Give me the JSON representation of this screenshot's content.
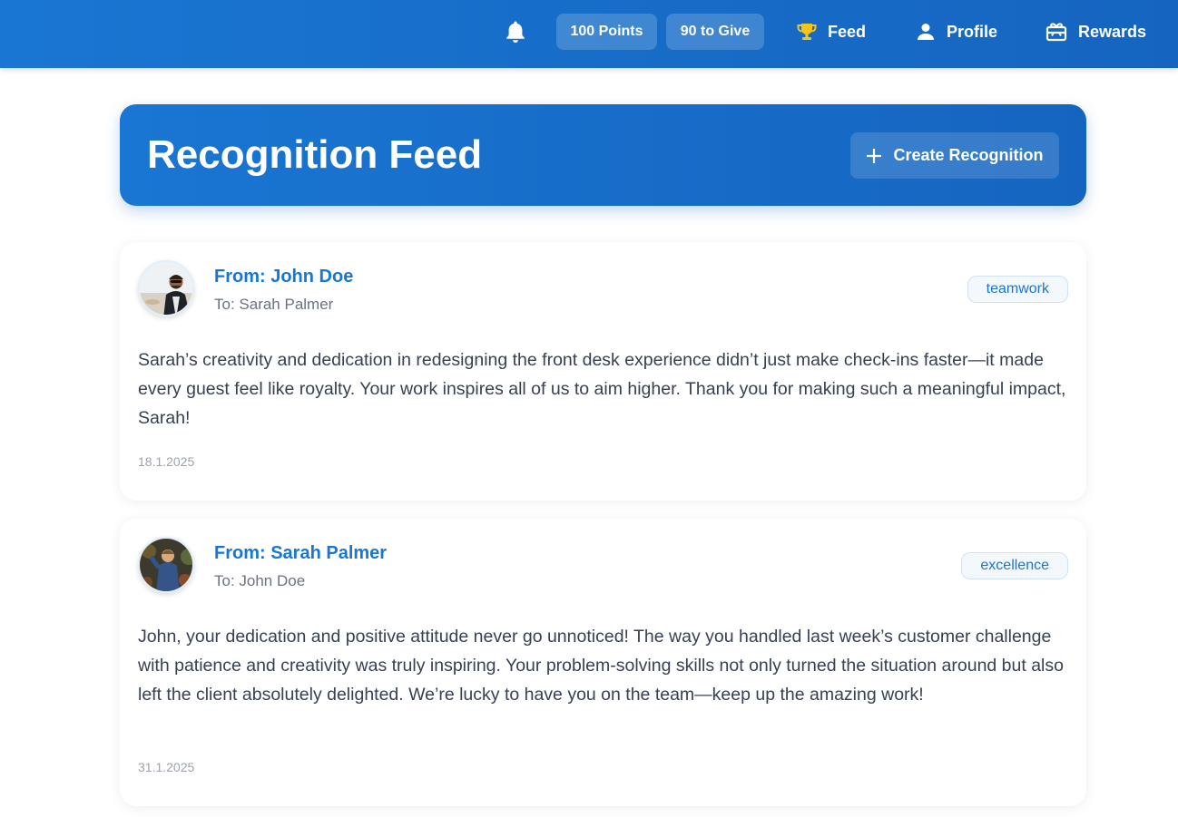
{
  "header": {
    "notifications_icon": "bell-icon",
    "points_label": "100 Points",
    "give_label": "90 to Give",
    "nav": [
      {
        "label": "Feed",
        "icon": "trophy-icon",
        "icon_color": "#f5c518"
      },
      {
        "label": "Profile",
        "icon": "person-icon"
      },
      {
        "label": "Rewards",
        "icon": "gift-card-icon"
      }
    ],
    "background": "#1976d2"
  },
  "hero": {
    "title": "Recognition Feed",
    "create_label": "Create Recognition",
    "create_icon": "plus-icon"
  },
  "recognitions": [
    {
      "from": "From: John Doe",
      "to": "To: Sarah Palmer",
      "tag": "teamwork",
      "message": "Sarah’s creativity and dedication in redesigning the front desk experience didn’t just make check-ins faster—it made every guest feel like royalty. Your work inspires all of us to aim higher. Thank you for making such a meaningful impact, Sarah!",
      "date": "18.1.2025"
    },
    {
      "from": "From: Sarah Palmer",
      "to": "To: John Doe",
      "tag": "excellence",
      "message": "John, your dedication and positive attitude never go unnoticed! The way you handled last week’s customer challenge with patience and creativity was truly inspiring. Your problem-solving skills not only turned the situation around but also left the client absolutely delighted. We’re lucky to have you on the team—keep up the amazing work!",
      "date": "31.1.2025"
    }
  ],
  "colors": {
    "accent": "#1976d2",
    "accent_dark": "#1565c0",
    "muted_text": "#6b7280",
    "date_text": "#9ca3af"
  }
}
